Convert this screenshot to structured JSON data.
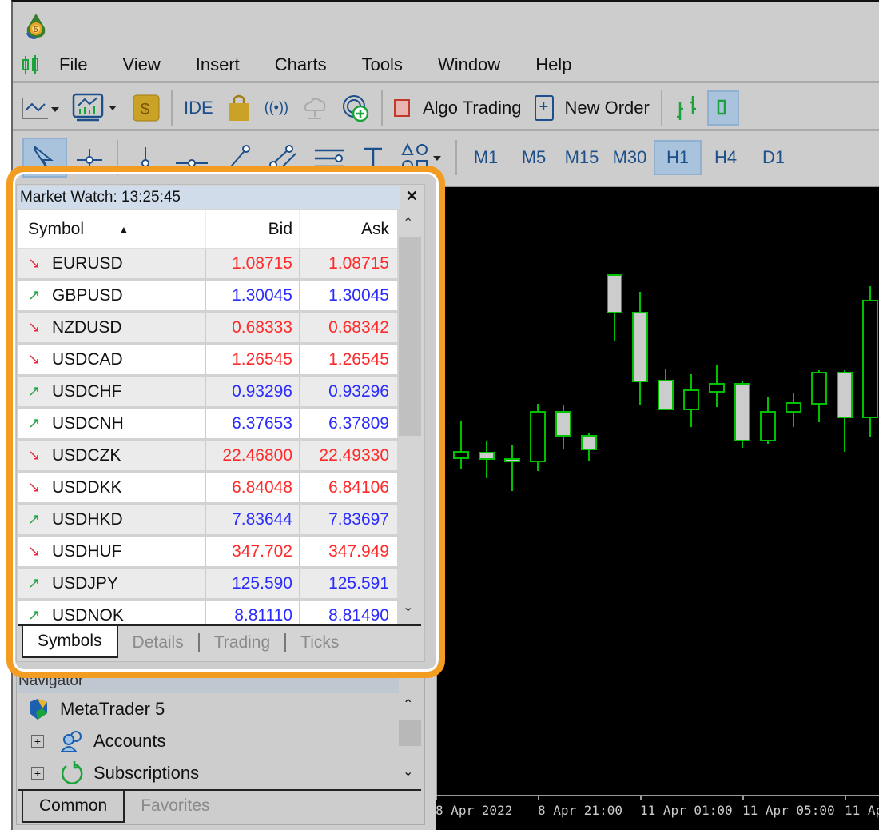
{
  "menu": [
    "File",
    "View",
    "Insert",
    "Charts",
    "Tools",
    "Window",
    "Help"
  ],
  "toolbar": {
    "ide": "IDE",
    "algo_trading": "Algo Trading",
    "new_order": "New Order"
  },
  "timeframes": [
    "M1",
    "M5",
    "M15",
    "M30",
    "H1",
    "H4",
    "D1"
  ],
  "selected_timeframe": "H1",
  "market_watch": {
    "title": "Market Watch: 13:25:45",
    "columns": [
      "Symbol",
      "Bid",
      "Ask"
    ],
    "sort": "Symbol ascending",
    "rows": [
      {
        "symbol": "EURUSD",
        "dir": "down",
        "bid": "1.08715",
        "ask": "1.08715"
      },
      {
        "symbol": "GBPUSD",
        "dir": "up",
        "bid": "1.30045",
        "ask": "1.30045"
      },
      {
        "symbol": "NZDUSD",
        "dir": "down",
        "bid": "0.68333",
        "ask": "0.68342"
      },
      {
        "symbol": "USDCAD",
        "dir": "down",
        "bid": "1.26545",
        "ask": "1.26545"
      },
      {
        "symbol": "USDCHF",
        "dir": "up",
        "bid": "0.93296",
        "ask": "0.93296"
      },
      {
        "symbol": "USDCNH",
        "dir": "up",
        "bid": "6.37653",
        "ask": "6.37809"
      },
      {
        "symbol": "USDCZK",
        "dir": "down",
        "bid": "22.46800",
        "ask": "22.49330"
      },
      {
        "symbol": "USDDKK",
        "dir": "down",
        "bid": "6.84048",
        "ask": "6.84106"
      },
      {
        "symbol": "USDHKD",
        "dir": "up",
        "bid": "7.83644",
        "ask": "7.83697"
      },
      {
        "symbol": "USDHUF",
        "dir": "down",
        "bid": "347.702",
        "ask": "347.949"
      },
      {
        "symbol": "USDJPY",
        "dir": "up",
        "bid": "125.590",
        "ask": "125.591"
      },
      {
        "symbol": "USDNOK",
        "dir": "up",
        "bid": "8.81110",
        "ask": "8.81490"
      }
    ],
    "tabs": [
      "Symbols",
      "Details",
      "Trading",
      "Ticks"
    ],
    "active_tab": "Symbols"
  },
  "navigator": {
    "title": "Navigator",
    "root": "MetaTrader 5",
    "items": [
      "Accounts",
      "Subscriptions"
    ],
    "tabs": [
      "Common",
      "Favorites"
    ],
    "active_tab": "Common"
  },
  "colors": {
    "up": "#1aa33a",
    "down": "#e8283c",
    "price_up": "#2b2bff",
    "price_down": "#ff2a2a",
    "highlight": "#f39c22",
    "candle": "#00c000",
    "bear_body": "#cccccc"
  },
  "chart_data": {
    "type": "candlestick",
    "timeframe": "H1",
    "candles": [
      {
        "t": "8 Apr 18:00",
        "o": 427,
        "h": 474,
        "l": 413,
        "c": 435
      },
      {
        "t": "8 Apr 19:00",
        "o": 434,
        "h": 449,
        "l": 402,
        "c": 426
      },
      {
        "t": "8 Apr 20:00",
        "o": 426,
        "h": 444,
        "l": 386,
        "c": 423
      },
      {
        "t": "8 Apr 21:00",
        "o": 423,
        "h": 495,
        "l": 411,
        "c": 485
      },
      {
        "t": "8 Apr 22:00",
        "o": 485,
        "h": 493,
        "l": 438,
        "c": 455
      },
      {
        "t": "8 Apr 23:00",
        "o": 455,
        "h": 458,
        "l": 424,
        "c": 438
      },
      {
        "t": "11 Apr 00:00",
        "o": 656,
        "h": 656,
        "l": 574,
        "c": 609
      },
      {
        "t": "11 Apr 01:00",
        "o": 609,
        "h": 635,
        "l": 493,
        "c": 523
      },
      {
        "t": "11 Apr 02:00",
        "o": 524,
        "h": 538,
        "l": 488,
        "c": 488
      },
      {
        "t": "11 Apr 03:00",
        "o": 488,
        "h": 532,
        "l": 466,
        "c": 512
      },
      {
        "t": "11 Apr 04:00",
        "o": 510,
        "h": 544,
        "l": 491,
        "c": 520
      },
      {
        "t": "11 Apr 05:00",
        "o": 520,
        "h": 523,
        "l": 440,
        "c": 449
      },
      {
        "t": "11 Apr 06:00",
        "o": 449,
        "h": 504,
        "l": 445,
        "c": 485
      },
      {
        "t": "11 Apr 07:00",
        "o": 485,
        "h": 509,
        "l": 466,
        "c": 496
      },
      {
        "t": "11 Apr 08:00",
        "o": 495,
        "h": 537,
        "l": 472,
        "c": 534
      },
      {
        "t": "11 Apr 09:00",
        "o": 534,
        "h": 537,
        "l": 435,
        "c": 478
      },
      {
        "t": "11 Apr 10:00",
        "o": 478,
        "h": 642,
        "l": 453,
        "c": 624
      }
    ],
    "xticks": [
      "8 Apr 2022",
      "8 Apr 21:00",
      "11 Apr 01:00",
      "11 Apr 05:00",
      "11 Ap"
    ],
    "ylim": [
      -38,
      768
    ],
    "grid": false
  }
}
